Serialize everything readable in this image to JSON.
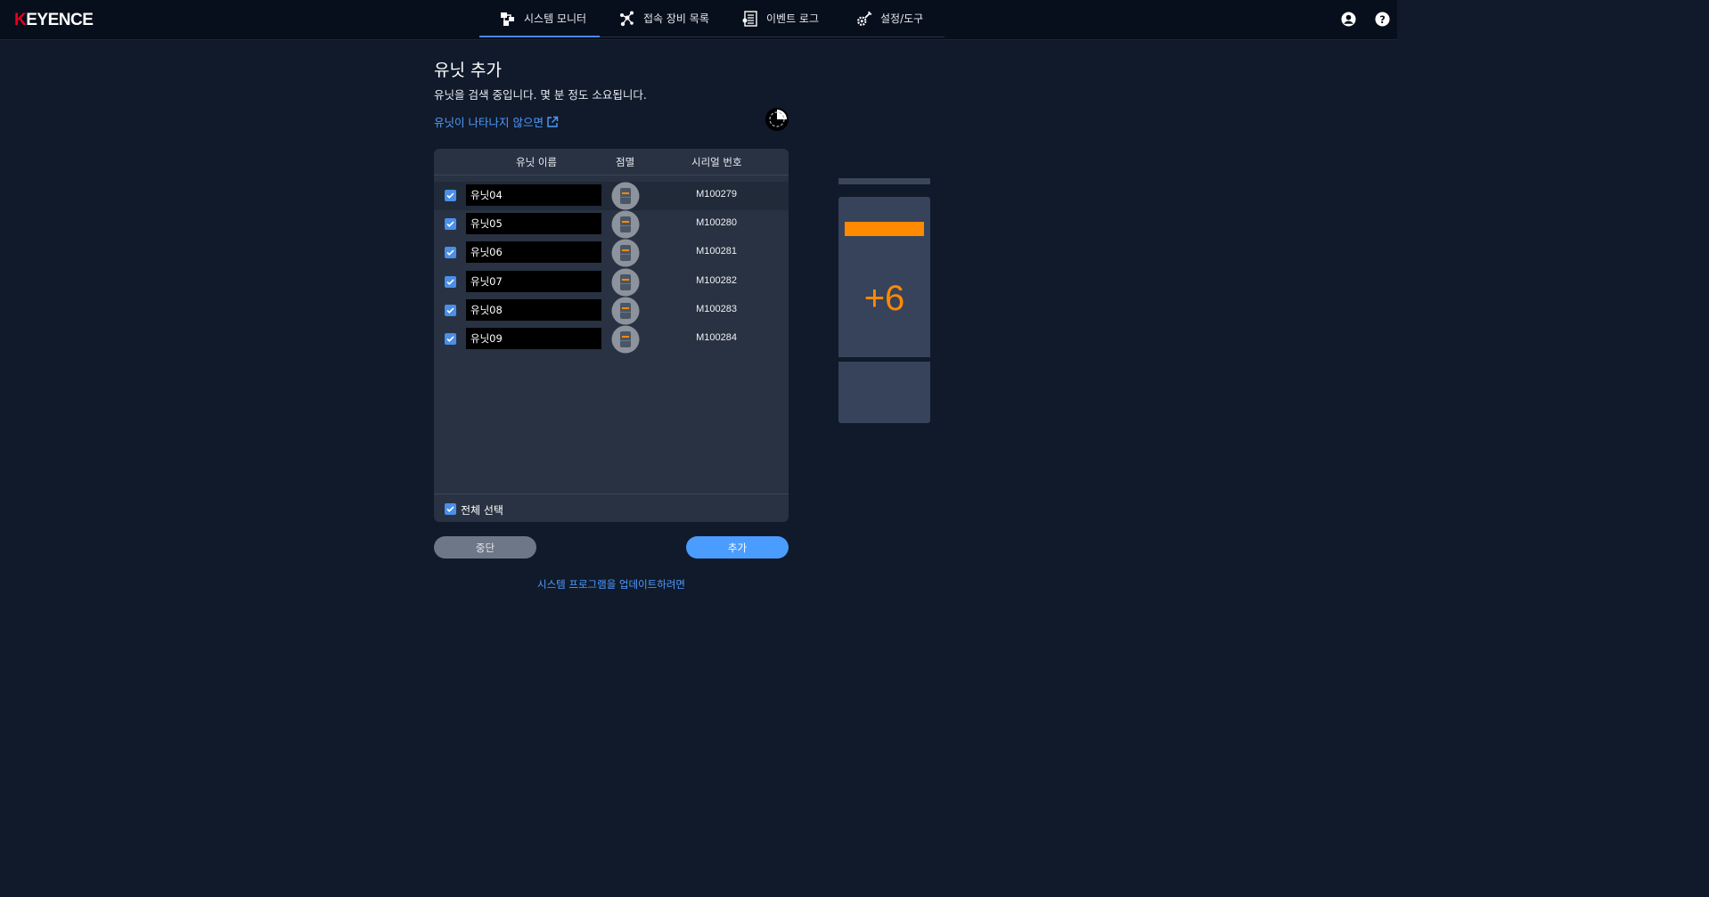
{
  "header": {
    "logo": "KEYENCE",
    "nav": [
      {
        "label": "시스템 모니터",
        "icon": "system-monitor-icon",
        "active": true
      },
      {
        "label": "접속 장비 목록",
        "icon": "network-icon",
        "active": false
      },
      {
        "label": "이벤트 로그",
        "icon": "event-log-icon",
        "active": false
      },
      {
        "label": "설정/도구",
        "icon": "settings-tools-icon",
        "active": false
      }
    ]
  },
  "dialog": {
    "title": "유닛 추가",
    "subtitle": "유닛을 검색 중입니다. 몇 분 정도 소요됩니다.",
    "help_link": "유닛이 나타나지 않으면",
    "columns": {
      "name": "유닛 이름",
      "blink": "점멸",
      "serial": "시리얼 번호"
    },
    "units": [
      {
        "name": "유닛04",
        "serial": "M100279",
        "checked": true
      },
      {
        "name": "유닛05",
        "serial": "M100280",
        "checked": true
      },
      {
        "name": "유닛06",
        "serial": "M100281",
        "checked": true
      },
      {
        "name": "유닛07",
        "serial": "M100282",
        "checked": true
      },
      {
        "name": "유닛08",
        "serial": "M100283",
        "checked": true
      },
      {
        "name": "유닛09",
        "serial": "M100284",
        "checked": true
      }
    ],
    "select_all": "전체 선택",
    "cancel_label": "중단",
    "add_label": "추가",
    "update_link": "시스템 프로그램을 업데이트하려면"
  },
  "preview": {
    "count": "+6"
  },
  "colors": {
    "accent": "#4a9cff",
    "orange": "#ff8a00",
    "background": "#101a2b"
  }
}
